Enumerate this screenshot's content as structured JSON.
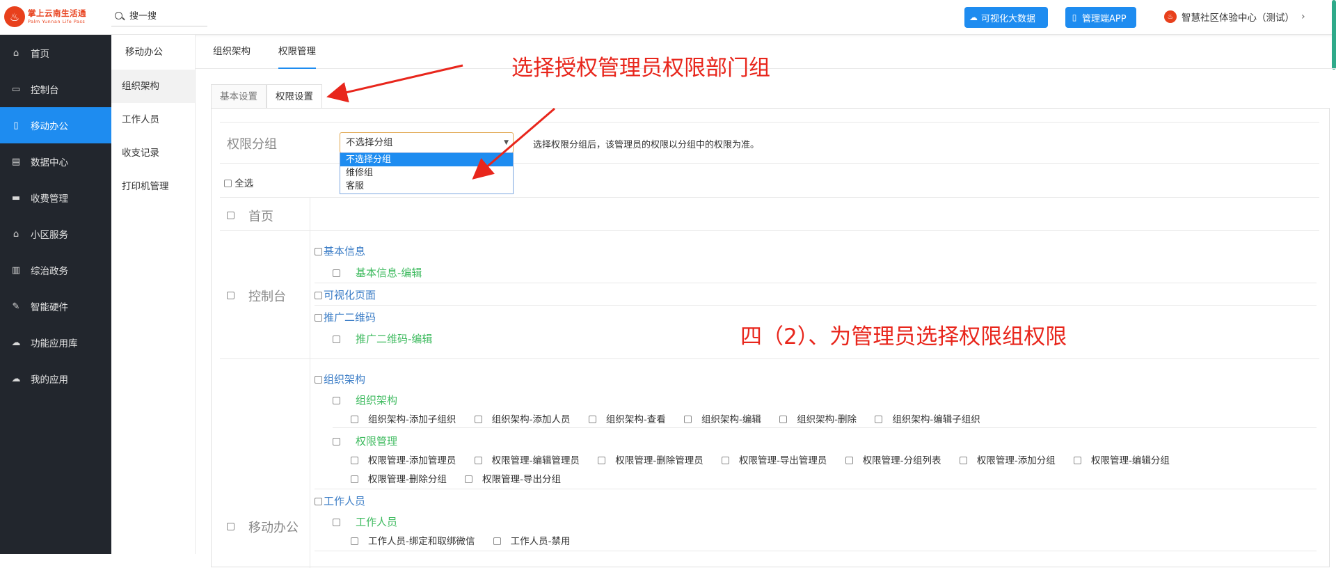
{
  "header": {
    "logo_cn": "掌上云南生活通",
    "logo_en": "Palm Yunnan Life Pass",
    "search_placeholder": "搜一搜",
    "btn_bigdata": "可视化大数据",
    "btn_app": "管理端APP",
    "user_name": "智慧社区体验中心（测试）"
  },
  "sidebar": {
    "items": [
      {
        "label": "首页",
        "icon": "home-icon"
      },
      {
        "label": "控制台",
        "icon": "laptop-icon"
      },
      {
        "label": "移动办公",
        "icon": "mobile-icon"
      },
      {
        "label": "数据中心",
        "icon": "briefcase-icon"
      },
      {
        "label": "收费管理",
        "icon": "credit-card-icon"
      },
      {
        "label": "小区服务",
        "icon": "home-icon"
      },
      {
        "label": "综治政务",
        "icon": "bank-icon"
      },
      {
        "label": "智能硬件",
        "icon": "wrench-icon"
      },
      {
        "label": "功能应用库",
        "icon": "cloud-download-icon"
      },
      {
        "label": "我的应用",
        "icon": "cloud-icon"
      }
    ],
    "active_index": 2
  },
  "subbar": {
    "title": "移动办公",
    "items": [
      "组织架构",
      "工作人员",
      "收支记录",
      "打印机管理"
    ]
  },
  "tabs": {
    "top": [
      "组织架构",
      "权限管理"
    ],
    "panel": [
      "基本设置",
      "权限设置"
    ]
  },
  "group": {
    "label": "权限分组",
    "selected": "不选择分组",
    "hint": "选择权限分组后，该管理员的权限以分组中的权限为准。",
    "options": [
      "不选择分组",
      "维修组",
      "客服"
    ]
  },
  "select_all": "全选",
  "sections": {
    "home": "首页",
    "ctrl": "控制台",
    "mob": "移动办公"
  },
  "ctrl": {
    "basic": "基本信息",
    "basic_edit": "基本信息-编辑",
    "visual": "可视化页面",
    "qr": "推广二维码",
    "qr_edit": "推广二维码-编辑"
  },
  "mob": {
    "org_l1": "组织架构",
    "org_l2": "组织架构",
    "org_perms": [
      "组织架构-添加子组织",
      "组织架构-添加人员",
      "组织架构-查看",
      "组织架构-编辑",
      "组织架构-删除",
      "组织架构-编辑子组织"
    ],
    "perm_l2": "权限管理",
    "perm_row1": [
      "权限管理-添加管理员",
      "权限管理-编辑管理员",
      "权限管理-删除管理员",
      "权限管理-导出管理员",
      "权限管理-分组列表",
      "权限管理-添加分组",
      "权限管理-编辑分组"
    ],
    "perm_row2": [
      "权限管理-删除分组",
      "权限管理-导出分组"
    ],
    "staff_l1": "工作人员",
    "staff_l2": "工作人员",
    "staff_perms": [
      "工作人员-绑定和取绑微信",
      "工作人员-禁用"
    ]
  },
  "annotations": {
    "a1": "选择授权管理员权限部门组",
    "a2": "四（2）、为管理员选择权限组权限",
    "color": "#e8261c"
  }
}
